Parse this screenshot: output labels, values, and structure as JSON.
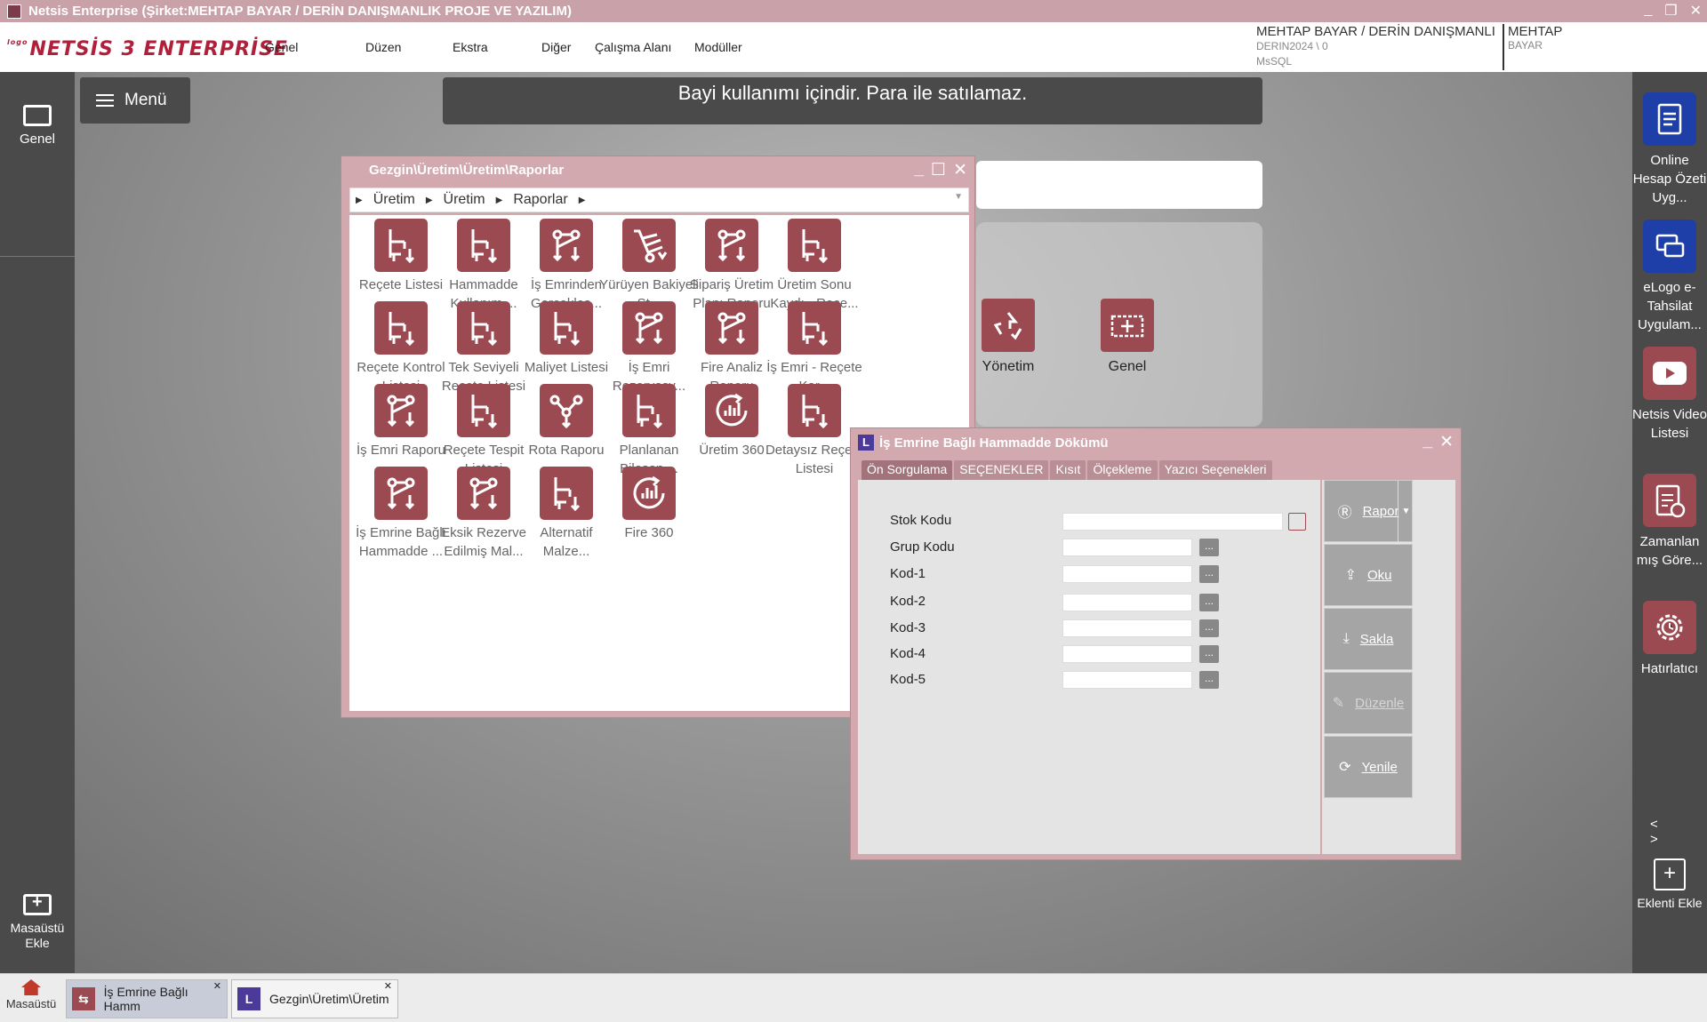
{
  "window": {
    "title": "Netsis Enterprise (Şirket:MEHTAP BAYAR / DERİN DANIŞMANLIK PROJE VE YAZILIM)"
  },
  "brand": {
    "logo_small": "logo",
    "logo_text": "NETSİS 3 ENTERPRİSE",
    "accent": "#9c4a52",
    "brand_red": "#b0203a"
  },
  "menu": {
    "items": [
      "Genel",
      "Düzen",
      "Ekstra",
      "Diğer",
      "Çalışma Alanı",
      "Modüller"
    ]
  },
  "user": {
    "name": "MEHTAP BAYAR / DERİN DANIŞMANLI",
    "db": "DERIN2024 \\ 0",
    "engine": "MsSQL",
    "name2": "MEHTAP",
    "name2_sub": "BAYAR"
  },
  "left_sidebar": {
    "genel": "Genel",
    "add_desktop": "Masaüstü Ekle"
  },
  "menu_button": {
    "label": "Menü"
  },
  "banner": {
    "text": "Bayi kullanımı içindir. Para ile satılamaz."
  },
  "desktop_icons": [
    {
      "label": "Yönetim",
      "icon": "recycle-icon"
    },
    {
      "label": "Genel",
      "icon": "move-icon"
    }
  ],
  "right_sidebar": {
    "items": [
      {
        "label": "Online Hesap Özeti Uyg...",
        "icon": "document-icon",
        "color": "#1f3fa8"
      },
      {
        "label": "eLogo e-Tahsilat Uygulam...",
        "icon": "card-icon",
        "color": "#1f3fa8"
      },
      {
        "label": "Netsis Video Listesi",
        "icon": "youtube-icon",
        "color": "#9c4a52"
      },
      {
        "label": "Zamanlan mış Göre...",
        "icon": "clipboard-clock-icon",
        "color": "#9c4a52"
      },
      {
        "label": "Hatırlatıcı",
        "icon": "gear-clock-icon",
        "color": "#9c4a52"
      }
    ],
    "nav": "< >",
    "add_label": "Eklenti Ekle"
  },
  "explorer": {
    "title": "Gezgin\\Üretim\\Üretim\\Raporlar",
    "breadcrumb": [
      "Üretim",
      "Üretim",
      "Raporlar"
    ],
    "items": [
      {
        "label": "Reçete Listesi",
        "icon": "tree-icon"
      },
      {
        "label": "Hammadde Kullanım ...",
        "icon": "tree-icon"
      },
      {
        "label": "İş Emrinden Gerçekleş...",
        "icon": "share-icon"
      },
      {
        "label": "Yürüyen Bakiyeli St...",
        "icon": "cart-icon"
      },
      {
        "label": "Sipariş Üretim Planı Raporu",
        "icon": "share-icon"
      },
      {
        "label": "Üretim Sonu Kaydı - Reçe...",
        "icon": "tree-icon"
      },
      {
        "label": "Reçete Kontrol Listesi",
        "icon": "tree-icon"
      },
      {
        "label": "Tek Seviyeli Reçete Listesi",
        "icon": "tree-icon"
      },
      {
        "label": "Maliyet Listesi",
        "icon": "tree-icon"
      },
      {
        "label": "İş Emri Rezervasy...",
        "icon": "share-icon"
      },
      {
        "label": "Fire Analiz Raporu",
        "icon": "share-icon"
      },
      {
        "label": "İş Emri - Reçete Kar...",
        "icon": "tree-icon"
      },
      {
        "label": "İş Emri Raporu",
        "icon": "share-icon"
      },
      {
        "label": "Reçete Tespit Listesi",
        "icon": "tree-icon"
      },
      {
        "label": "Rota Raporu",
        "icon": "route-icon"
      },
      {
        "label": "Planlanan Bileşen ...",
        "icon": "tree-icon"
      },
      {
        "label": "Üretim 360",
        "icon": "chart-360-icon"
      },
      {
        "label": "Detaysız Reçete Listesi",
        "icon": "tree-icon"
      },
      {
        "label": "İş Emrine Bağlı Hammadde ...",
        "icon": "share-icon"
      },
      {
        "label": "Eksik Rezerve Edilmiş Mal...",
        "icon": "share-icon"
      },
      {
        "label": "Alternatif Malze...",
        "icon": "tree-icon"
      },
      {
        "label": "Fire 360",
        "icon": "chart-360-icon"
      }
    ]
  },
  "dialog": {
    "title": "İş Emrine Bağlı Hammadde Dökümü",
    "logo": "L",
    "tabs": [
      "Ön Sorgulama",
      "SEÇENEKLER",
      "Kısıt",
      "Ölçekleme",
      "Yazıcı Seçenekleri"
    ],
    "fields": [
      {
        "label": "Stok Kodu",
        "value": ""
      },
      {
        "label": "Grup Kodu",
        "value": ""
      },
      {
        "label": "Kod-1",
        "value": ""
      },
      {
        "label": "Kod-2",
        "value": ""
      },
      {
        "label": "Kod-3",
        "value": ""
      },
      {
        "label": "Kod-4",
        "value": ""
      },
      {
        "label": "Kod-5",
        "value": ""
      }
    ],
    "dots": "...",
    "actions": {
      "rapor": "Rapor",
      "oku": "Oku",
      "sakla": "Sakla",
      "duzenle": "Düzenle",
      "yenile": "Yenile"
    }
  },
  "taskbar": {
    "home": "Masaüstü",
    "items": [
      {
        "label": "İş Emrine Bağlı Hamm",
        "active": true
      },
      {
        "label": "Gezgin\\Üretim\\Üretim",
        "active": false
      }
    ]
  }
}
